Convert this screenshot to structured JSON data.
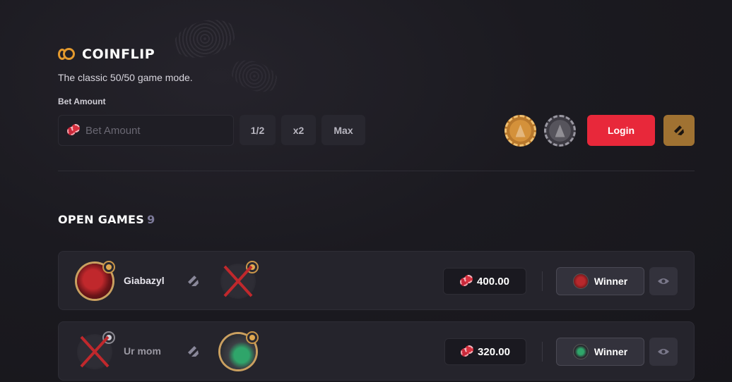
{
  "header": {
    "title": "COINFLIP",
    "subtitle": "The classic 50/50 game mode."
  },
  "bet": {
    "label": "Bet Amount",
    "placeholder": "Bet Amount",
    "half_label": "1/2",
    "double_label": "x2",
    "max_label": "Max"
  },
  "actions": {
    "login_label": "Login"
  },
  "open_games": {
    "title": "OPEN GAMES",
    "count": "9"
  },
  "games": [
    {
      "player": "Giabazyl",
      "amount": "400.00",
      "winner_label": "Winner"
    },
    {
      "player": "Ur mom",
      "amount": "320.00",
      "winner_label": "Winner"
    }
  ],
  "colors": {
    "accent_red": "#e8283a",
    "accent_gold": "#a07232",
    "coin_orange": "#e49a2e"
  }
}
